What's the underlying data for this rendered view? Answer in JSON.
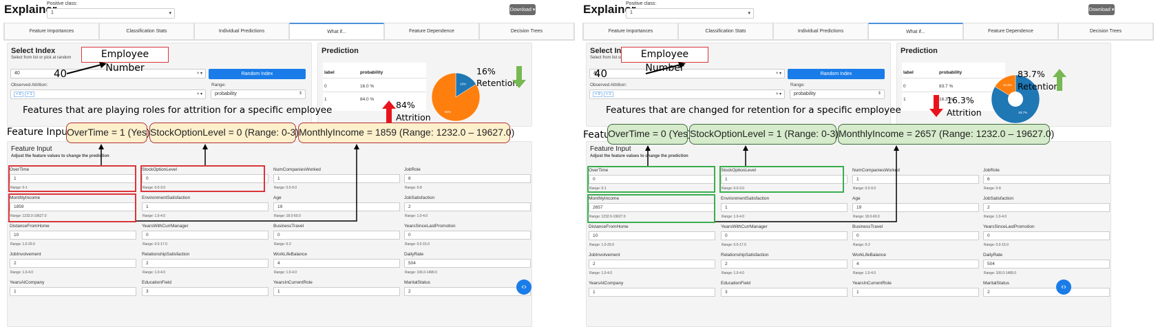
{
  "app": {
    "title": "Explainer",
    "positive_class_label": "Positive class:",
    "positive_class_value": "1",
    "download_label": "Download ▾"
  },
  "tabs": [
    "Feature Importances",
    "Classification Stats",
    "Individual Predictions",
    "What if...",
    "Feature Dependence",
    "Decision Trees"
  ],
  "select_index": {
    "title": "Select Index",
    "subtitle": "Select from list or pick at random",
    "index_value": "40",
    "random_button": "Random Index",
    "observed_label": "Observed Attrition:",
    "observed_tags": [
      "× 0",
      "× 1"
    ],
    "range_label": "Range:",
    "range_value": "probability"
  },
  "prediction": {
    "title": "Prediction",
    "col_label": "label",
    "col_prob": "probability"
  },
  "feature_input": {
    "title": "Feature Input",
    "subtitle": "Adjust the feature values to change the prediction"
  },
  "features_common": [
    {
      "name": "NumCompaniesWorked",
      "value": "1",
      "range": "Range: 0.0-9.0"
    },
    {
      "name": "JobRole",
      "value": "6",
      "range": "Range: 0-8"
    },
    {
      "name": "EnvironmentSatisfaction",
      "value": "1",
      "range": "Range: 1.0-4.0"
    },
    {
      "name": "Age",
      "value": "19",
      "range": "Range: 18.0-60.0"
    },
    {
      "name": "JobSatisfaction",
      "value": "2",
      "range": "Range: 1.0-4.0"
    },
    {
      "name": "DistanceFromHome",
      "value": "10",
      "range": "Range: 1.0-29.0"
    },
    {
      "name": "YearsWithCurrManager",
      "value": "0",
      "range": "Range: 0.0-17.0"
    },
    {
      "name": "BusinessTravel",
      "value": "0",
      "range": "Range: 0-2"
    },
    {
      "name": "YearsSinceLastPromotion",
      "value": "0",
      "range": "Range: 0.0-15.0"
    },
    {
      "name": "JobInvolvement",
      "value": "2",
      "range": "Range: 1.0-4.0"
    },
    {
      "name": "RelationshipSatisfaction",
      "value": "2",
      "range": "Range: 1.0-4.0"
    },
    {
      "name": "WorkLifeBalance",
      "value": "4",
      "range": "Range: 1.0-4.0"
    },
    {
      "name": "DailyRate",
      "value": "504",
      "range": "Range: 106.0-1499.0"
    },
    {
      "name": "YearsAtCompany",
      "value": "1",
      "range": ""
    },
    {
      "name": "EducationField",
      "value": "3",
      "range": ""
    },
    {
      "name": "YearsInCurrentRole",
      "value": "1",
      "range": ""
    },
    {
      "name": "MaritalStatus",
      "value": "2",
      "range": ""
    }
  ],
  "panels": [
    {
      "id": "attrition",
      "overtime": {
        "name": "OverTime",
        "value": "1",
        "range": "Range: 0-1"
      },
      "stock": {
        "name": "StockOptionLevel",
        "value": "0",
        "range": "Range: 0.0-3.0"
      },
      "income": {
        "name": "MonthlyIncome",
        "value": "1859",
        "range": "Range: 1232.0-19627.0"
      },
      "pred_rows": [
        {
          "label": "0",
          "prob": "16.0 %"
        },
        {
          "label": "1",
          "prob": "84.0 %"
        }
      ],
      "pie": {
        "class0": 16.0,
        "class1": 84.0,
        "label0": "16%",
        "label1": "84%"
      },
      "annot": {
        "employee": "Employee Number",
        "forty": "40",
        "top_pct": "16%",
        "top_word": "Retention",
        "mid_pct": "84%",
        "mid_word": "Attrition",
        "caption": "Features that are playing roles for attrition for a specific employee",
        "fi_label": "Feature Input",
        "fi_overtime": "OverTime = 1 (Yes)",
        "fi_stock": "StockOptionLevel = 0 (Range: 0-3)",
        "fi_income": "MonthlyIncome = 1859 (Range: 1232.0 – 19627.0)"
      }
    },
    {
      "id": "retention",
      "overtime": {
        "name": "OverTime",
        "value": "0",
        "range": "Range: 0-1"
      },
      "stock": {
        "name": "StockOptionLevel",
        "value": "1",
        "range": "Range: 0.0-3.0"
      },
      "income": {
        "name": "MonthlyIncome",
        "value": "2657",
        "range": "Range: 1232.0-19627.0"
      },
      "pred_rows": [
        {
          "label": "0",
          "prob": "83.7 %"
        },
        {
          "label": "1",
          "prob": "16.3 %"
        }
      ],
      "pie": {
        "class0": 83.7,
        "class1": 16.3,
        "label0": "83.7%",
        "label1": "16.3%"
      },
      "annot": {
        "employee": "Employee Number",
        "forty": "40",
        "top_pct": "83.7%",
        "top_word": "Retention",
        "mid_pct": "16.3%",
        "mid_word": "Attrition",
        "caption": "Features that are changed for retention for a specific employee",
        "fi_label": "Feature Input",
        "fi_overtime": "OverTime = 0 (Yes)",
        "fi_stock": "StockOptionLevel = 1 (Range: 0-3)",
        "fi_income": "MonthlyIncome = 2657 (Range: 1232.0 – 19627.0)"
      }
    }
  ],
  "colors": {
    "class0": "#1f77b4",
    "class1": "#ff7f0e",
    "attrition_box": "#d9343a",
    "retention_box": "#3aad4d",
    "fi_fill_attrition": "#fdf0cc",
    "fi_fill_retention": "#d6ebcb",
    "arrow_up_red": "#e8141c",
    "arrow_down_green": "#76b852"
  },
  "help_icon": "help-chevrons-icon"
}
